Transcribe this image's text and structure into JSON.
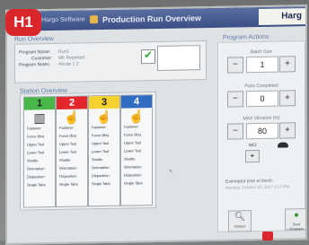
{
  "badge": "H1",
  "window": {
    "left_text": "Hargo Software",
    "title": "Production Run Overview",
    "brand": "Harg"
  },
  "overview": {
    "label": "Run Overview",
    "fields": [
      {
        "label": "Program Name:",
        "value": "Run1"
      },
      {
        "label": "Customer:",
        "value": "Mfr Reported"
      },
      {
        "label": "Program Notes:",
        "value": "Abcde 1 2"
      }
    ],
    "check_state": "checked"
  },
  "stations_overview": {
    "label": "Station Overview",
    "stations": [
      {
        "number": "1",
        "color": "#49b64a",
        "icon": "machine-icon",
        "lines": [
          "Fastener",
          "Force (lbs)",
          "Upper Tool",
          "Lower Tool",
          "Shuttle",
          "Orientation",
          "Disposition",
          "Single Tabs"
        ]
      },
      {
        "number": "2",
        "color": "#e2262c",
        "icon": "hand-icon",
        "lines": [
          "Fastener",
          "Force (lbs)",
          "Upper Tool",
          "Lower Tool",
          "Shuttle",
          "Orientation",
          "Disposition",
          "Single Tabs"
        ]
      },
      {
        "number": "3",
        "color": "#f4d12e",
        "icon": "hand-icon",
        "lines": [
          "Fastener",
          "Force (lbs)",
          "Upper Tool",
          "Lower Tool",
          "Shuttle",
          "Orientation",
          "Disposition",
          "Single Tabs"
        ]
      },
      {
        "number": "4",
        "color": "#2f6cc2",
        "icon": "hand-icon",
        "lines": [
          "Fastener",
          "Force (lbs)",
          "Upper Tool",
          "Lower Tool",
          "Shuttle",
          "Orientation",
          "Disposition",
          "Single Tabs"
        ]
      }
    ]
  },
  "program_actions": {
    "label": "Program Actions",
    "batch_size": {
      "label": "Batch Size",
      "value": "1"
    },
    "parts_completed": {
      "label": "Parts Completed",
      "value": "0"
    },
    "max_vibration": {
      "label": "MAX Vibration (%)",
      "value": "80"
    },
    "mo": {
      "label": "MO:"
    },
    "estimated": {
      "label": "Estimated time to finish:",
      "value": "Monday, October 21, 2017 4:17 PM"
    },
    "buttons": {
      "inspect": "Inspect",
      "start": "Start Program"
    }
  },
  "colors": {
    "station1": "#49b64a",
    "station2": "#e2262c",
    "station3": "#f4d12e",
    "station4": "#2f6cc2"
  }
}
